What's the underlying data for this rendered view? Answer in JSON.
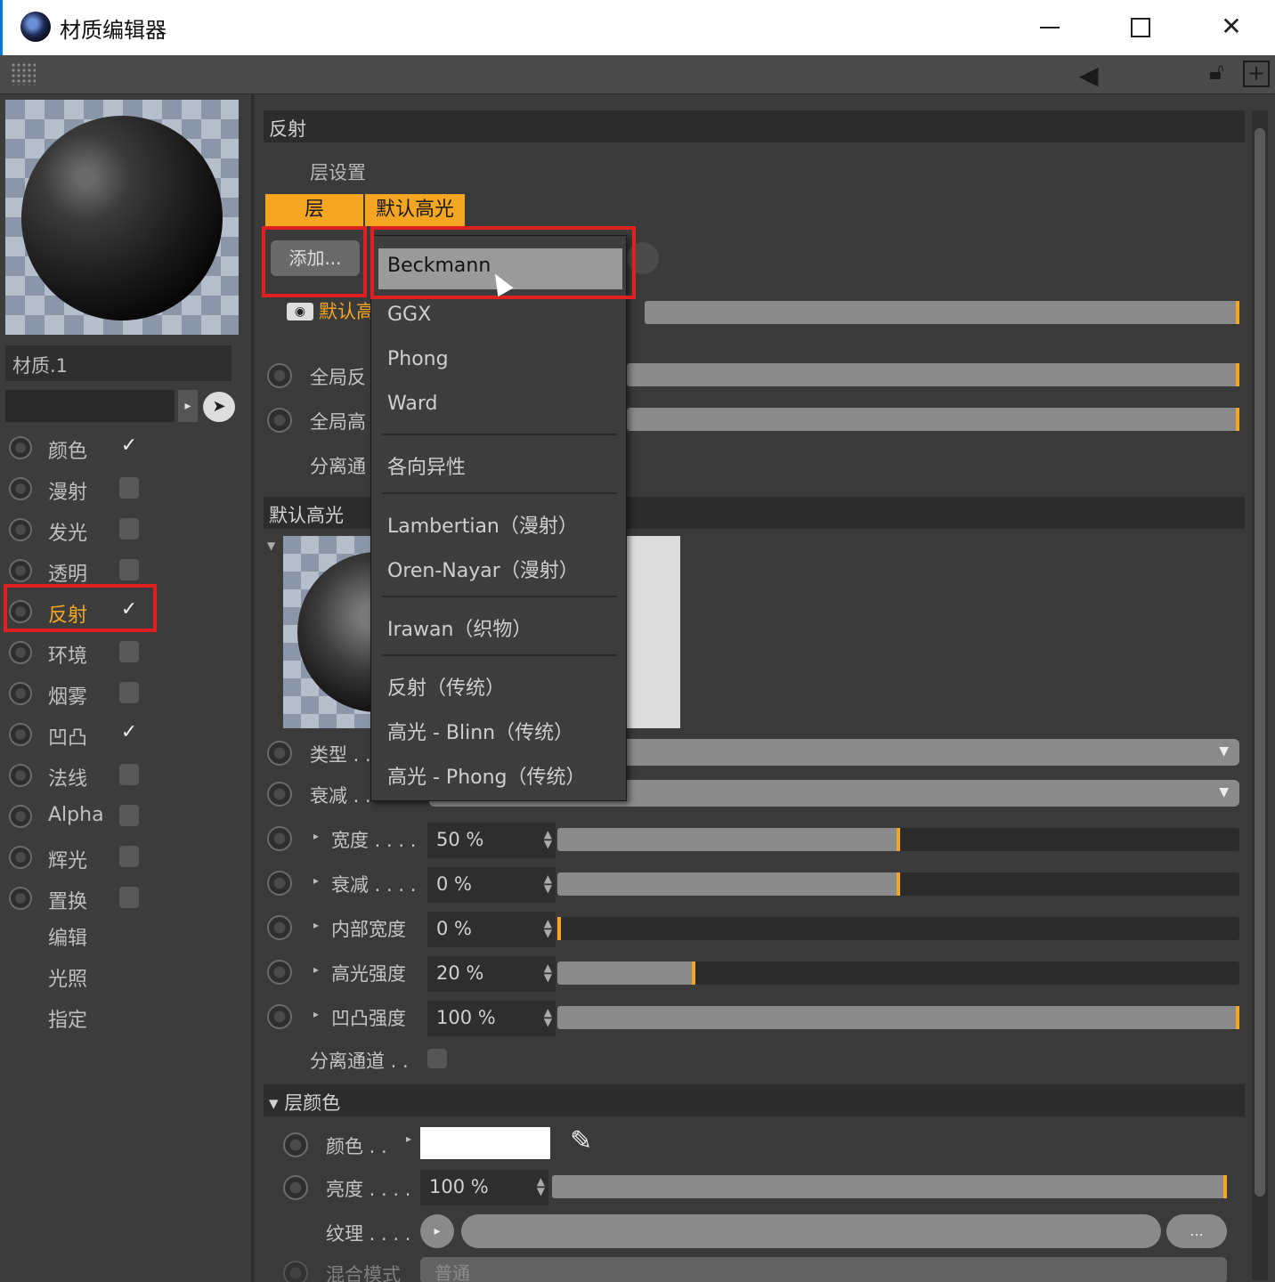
{
  "window": {
    "title": "材质编辑器",
    "minimize": "—",
    "maximize": "□",
    "close": "✕"
  },
  "toolbar": {
    "icons": [
      "arrow-left-icon",
      "lock-icon",
      "new-window-icon"
    ]
  },
  "left": {
    "material_name": "材质.1",
    "channels": [
      {
        "label": "颜色",
        "checked": true
      },
      {
        "label": "漫射",
        "checked": false
      },
      {
        "label": "发光",
        "checked": false
      },
      {
        "label": "透明",
        "checked": false
      },
      {
        "label": "反射",
        "checked": true,
        "active": true
      },
      {
        "label": "环境",
        "checked": false
      },
      {
        "label": "烟雾",
        "checked": false
      },
      {
        "label": "凹凸",
        "checked": true
      },
      {
        "label": "法线",
        "checked": false
      },
      {
        "label": "Alpha",
        "checked": false
      },
      {
        "label": "辉光",
        "checked": false
      },
      {
        "label": "置换",
        "checked": false
      }
    ],
    "extras": [
      "编辑",
      "光照",
      "指定"
    ],
    "check_glyph": "✓"
  },
  "right": {
    "section_reflect": "反射",
    "layer_settings": "层设置",
    "tabs": [
      "层",
      "默认高光"
    ],
    "add_button": "添加...",
    "layer_row_label": "默认高",
    "global_reflect": "全局反",
    "global_highlight": "全局高",
    "separate_pass": "分离通",
    "section_default_spec": "默认高光",
    "type_label": "类型 . .",
    "attenuation_label": "衰减 . .",
    "params": [
      {
        "label": "宽度 . . . .",
        "value": "50 %",
        "fill": 0.5
      },
      {
        "label": "衰减 . . . .",
        "value": "0 %",
        "fill": 0.5
      },
      {
        "label": "内部宽度",
        "value": "0 %",
        "fill": 0.0
      },
      {
        "label": "高光强度",
        "value": "20 %",
        "fill": 0.2
      },
      {
        "label": "凹凸强度",
        "value": "100 %",
        "fill": 1.0
      }
    ],
    "separate_pass_full": "分离通道 . .",
    "section_layer_color": "▾ 层颜色",
    "color_label": "颜色 . .",
    "brightness_label": "亮度 . . . .",
    "brightness_value": "100 %",
    "texture_label": "纹理 . . . .",
    "texture_more": "...",
    "blend_label": "混合模式",
    "blend_value": "普通"
  },
  "dropdown": {
    "items": [
      "Beckmann",
      "GGX",
      "Phong",
      "Ward",
      "各向异性",
      "Lambertian（漫射）",
      "Oren-Nayar（漫射）",
      "Irawan（织物）",
      "反射（传统）",
      "高光 - Blinn（传统）",
      "高光 - Phong（传统）"
    ],
    "selected": "Beckmann"
  },
  "colors": {
    "accent": "#f5a623",
    "highlight": "#e02020",
    "panel": "#3a3a3a"
  }
}
